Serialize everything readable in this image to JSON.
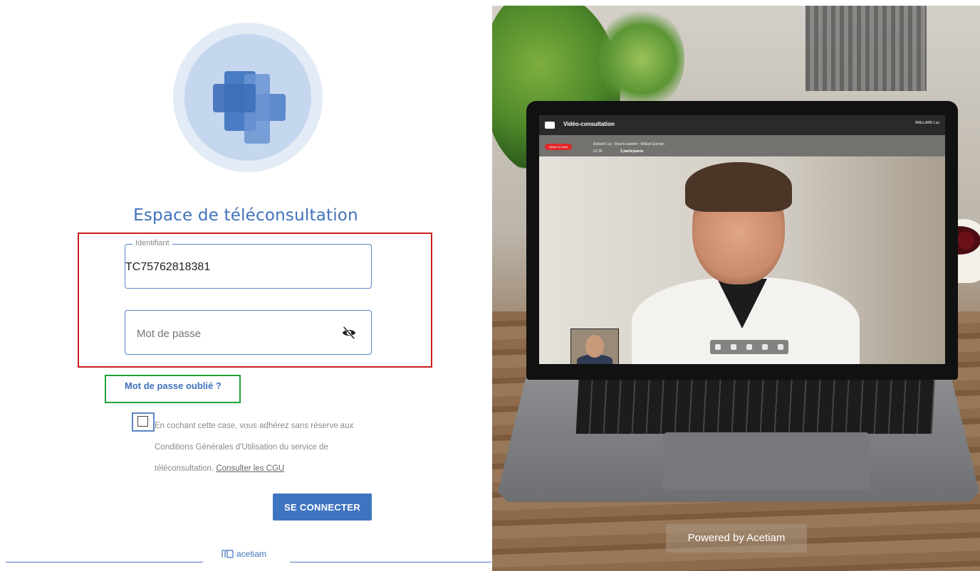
{
  "login": {
    "title": "Espace de téléconsultation",
    "username": {
      "legend": "Identifiant",
      "value": "TC75762818381"
    },
    "password": {
      "placeholder": "Mot de passe"
    },
    "forgot_label": "Mot de passe oublié ?",
    "terms_text": "En cochant cette case, vous adhérez sans réserve aux Conditions Générales d'Utilisation du service de téléconsultation.",
    "terms_link": "Consulter les CGU",
    "submit_label": "SE CONNECTER",
    "brand": "acetiam"
  },
  "preview": {
    "app_title": "Vidéo-consultation",
    "user_label": "BAILLARD Luc",
    "quit_label": "Quitter la visite",
    "participants_names": "Baillard Luc ; Briard Isabelle ; Millard Quentin",
    "elapsed": "01:36",
    "participants_count": "3 participants",
    "powered_by": "Powered by Acetiam"
  },
  "colors": {
    "accent": "#3f72ba",
    "button": "#3f74c0",
    "highlight_red": "#c81e1e",
    "highlight_green": "#1ea33a",
    "highlight_blue": "#5b86c4"
  },
  "icons": {
    "logo": "medical-cross-icon",
    "password_toggle": "eye-slash-icon",
    "brand": "acetiam-logo-icon"
  }
}
